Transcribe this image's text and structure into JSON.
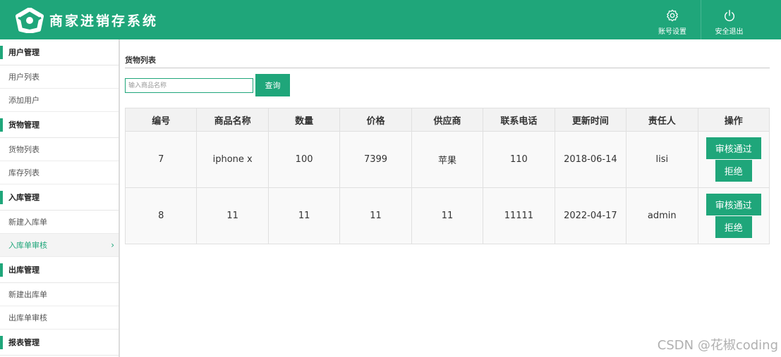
{
  "header": {
    "title": "商家进销存系统",
    "settings_label": "账号设置",
    "logout_label": "安全退出"
  },
  "sidebar": {
    "groups": [
      {
        "title": "用户管理",
        "items": [
          {
            "label": "用户列表"
          },
          {
            "label": "添加用户"
          }
        ]
      },
      {
        "title": "货物管理",
        "items": [
          {
            "label": "货物列表"
          },
          {
            "label": "库存列表"
          }
        ]
      },
      {
        "title": "入库管理",
        "items": [
          {
            "label": "新建入库单"
          },
          {
            "label": "入库单审核",
            "chevron": "›"
          }
        ]
      },
      {
        "title": "出库管理",
        "items": [
          {
            "label": "新建出库单"
          },
          {
            "label": "出库单审核"
          }
        ]
      },
      {
        "title": "报表管理",
        "items": []
      }
    ]
  },
  "main": {
    "title": "货物列表",
    "search": {
      "placeholder": "输入商品名称",
      "button_label": "查询"
    },
    "table": {
      "headers": [
        "编号",
        "商品名称",
        "数量",
        "价格",
        "供应商",
        "联系电话",
        "更新时间",
        "责任人",
        "操作"
      ],
      "rows": [
        {
          "id": "7",
          "name": "iphone x",
          "qty": "100",
          "price": "7399",
          "supplier": "苹果",
          "phone": "110",
          "updated": "2018-06-14",
          "owner": "lisi",
          "approve": "审核通过",
          "reject": "拒绝"
        },
        {
          "id": "8",
          "name": "11",
          "qty": "11",
          "price": "11",
          "supplier": "11",
          "phone": "11111",
          "updated": "2022-04-17",
          "owner": "admin",
          "approve": "审核通过",
          "reject": "拒绝"
        }
      ]
    }
  },
  "watermark": "CSDN @花椒coding",
  "colors": {
    "accent": "#1fa67a"
  },
  "icons": {
    "logo": "logo-icon",
    "settings": "gear-icon",
    "logout": "power-icon",
    "chevron": "chevron-right-icon"
  }
}
